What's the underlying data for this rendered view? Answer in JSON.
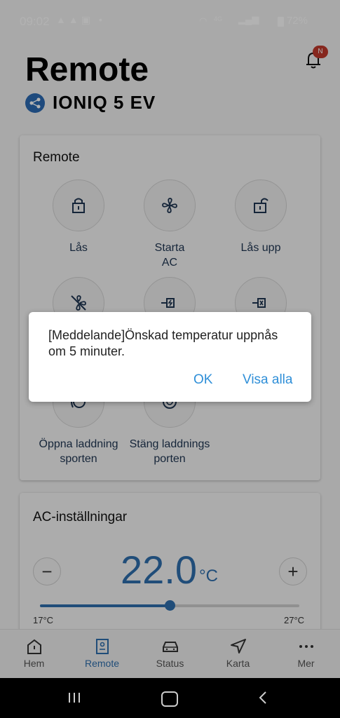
{
  "status_bar": {
    "time": "09:02",
    "battery": "72%",
    "network": "4G"
  },
  "header": {
    "title": "Remote",
    "vehicle": "IONIQ 5 EV",
    "notification_badge": "N"
  },
  "remote_card": {
    "title": "Remote",
    "controls": [
      {
        "label": "Lås",
        "icon": "lock-icon"
      },
      {
        "label": "Starta\nAC",
        "icon": "fan-icon"
      },
      {
        "label": "Lås upp",
        "icon": "unlock-icon"
      },
      {
        "label": "",
        "icon": "fan-off-icon"
      },
      {
        "label": "",
        "icon": "charge-start-icon"
      },
      {
        "label": "",
        "icon": "charge-stop-icon"
      },
      {
        "label": "Öppna laddning\nsporten",
        "icon": "charge-port-open-icon"
      },
      {
        "label": "Stäng laddnings\nporten",
        "icon": "charge-port-close-icon"
      }
    ]
  },
  "ac_card": {
    "title": "AC-inställningar",
    "temperature": "22.0",
    "unit": "°C",
    "min_label": "17°C",
    "max_label": "27°C",
    "level": 0.5
  },
  "bottom_nav": [
    {
      "label": "Hem",
      "icon": "home-icon",
      "active": false
    },
    {
      "label": "Remote",
      "icon": "remote-icon",
      "active": true
    },
    {
      "label": "Status",
      "icon": "car-icon",
      "active": false
    },
    {
      "label": "Karta",
      "icon": "navigation-icon",
      "active": false
    },
    {
      "label": "Mer",
      "icon": "more-icon",
      "active": false
    }
  ],
  "dialog": {
    "message": "[Meddelande]Önskad temperatur uppnås om 5 minuter.",
    "ok_label": "OK",
    "view_all_label": "Visa alla"
  },
  "colors": {
    "accent": "#2f6fae",
    "link": "#2f8fd8",
    "badge": "#c0392b"
  }
}
